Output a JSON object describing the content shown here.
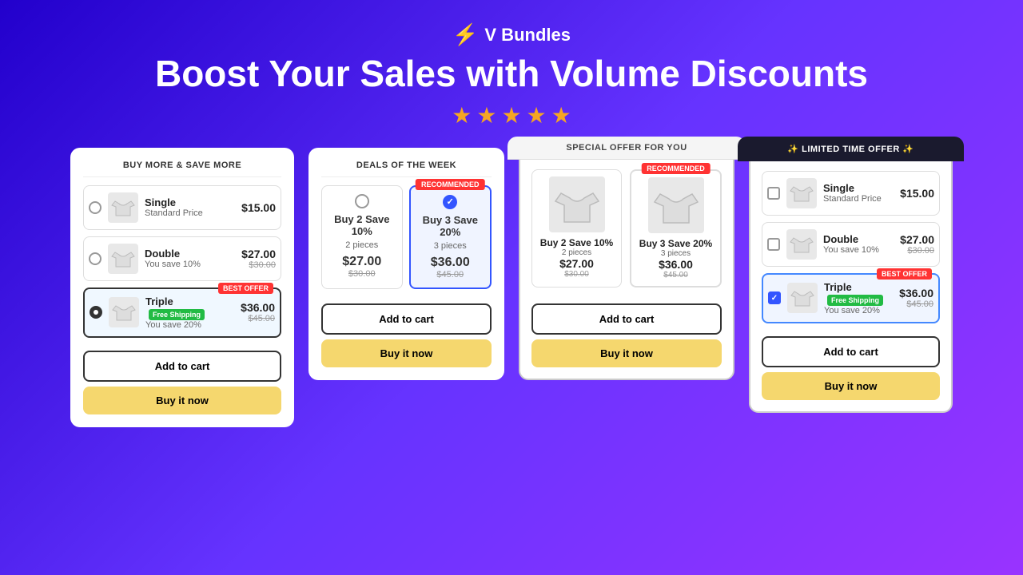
{
  "header": {
    "logo_text": "V Bundles",
    "logo_icon": "⚡",
    "main_title": "Boost Your Sales with Volume Discounts",
    "stars": [
      "★",
      "★",
      "★",
      "★",
      "★"
    ]
  },
  "card1": {
    "title": "BUY MORE & SAVE MORE",
    "items": [
      {
        "name": "Single",
        "subtitle": "Standard Price",
        "price": "$15.00",
        "original_price": null,
        "selected": false,
        "badge": null
      },
      {
        "name": "Double",
        "subtitle": "You save 10%",
        "price": "$27.00",
        "original_price": "$30.00",
        "selected": false,
        "badge": null
      },
      {
        "name": "Triple",
        "subtitle": "You save 20%",
        "price": "$36.00",
        "original_price": "$45.00",
        "selected": true,
        "badge": "Free Shipping",
        "best_offer": "BEST OFFER"
      }
    ],
    "add_to_cart": "Add to cart",
    "buy_now": "Buy it now"
  },
  "card2": {
    "title": "DEALS OF THE WEEK",
    "deals": [
      {
        "title": "Buy 2 Save 10%",
        "pieces": "2 pieces",
        "price": "$27.00",
        "original": "$30.00",
        "selected": false,
        "recommended": false
      },
      {
        "title": "Buy 3 Save 20%",
        "pieces": "3 pieces",
        "price": "$36.00",
        "original": "$45.00",
        "selected": true,
        "recommended": true,
        "recommended_label": "RECOMMENDED"
      }
    ],
    "add_to_cart": "Add to cart",
    "buy_now": "Buy it now"
  },
  "card3": {
    "title": "SPECIAL OFFER FOR YOU",
    "deals": [
      {
        "label": "Buy 2 Save 10%",
        "sublabel": "2 pieces",
        "price": "$27.00",
        "original": "$30.00",
        "recommended": false
      },
      {
        "label": "Buy 3 Save 20%",
        "sublabel": "3 pieces",
        "price": "$36.00",
        "original": "$45.00",
        "recommended": true,
        "recommended_label": "RECOMMENDED"
      }
    ],
    "add_to_cart": "Add to cart",
    "buy_now": "Buy it now"
  },
  "card4": {
    "title": "✨ LIMITED TIME OFFER ✨",
    "items": [
      {
        "name": "Single",
        "subtitle": "Standard Price",
        "price": "$15.00",
        "original_price": null,
        "selected": false,
        "badge": null
      },
      {
        "name": "Double",
        "subtitle": "You save 10%",
        "price": "$27.00",
        "original_price": "$30.00",
        "selected": false,
        "badge": null
      },
      {
        "name": "Triple",
        "subtitle": "You save 20%",
        "price": "$36.00",
        "original_price": "$45.00",
        "selected": true,
        "badge": "Free Shipping",
        "best_offer": "BEST OFFER"
      }
    ],
    "add_to_cart": "Add to cart",
    "buy_now": "Buy it now"
  }
}
